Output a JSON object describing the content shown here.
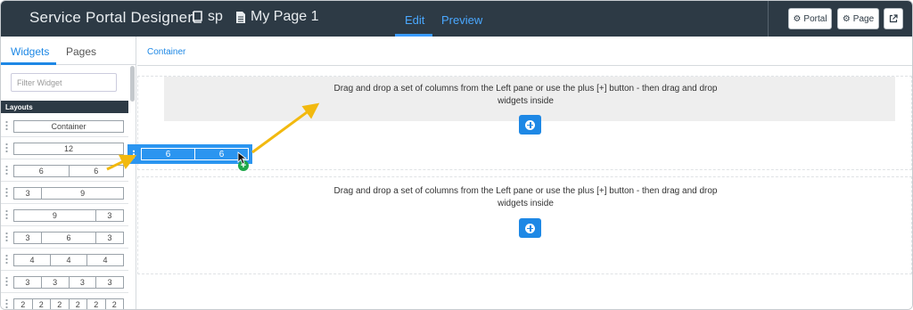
{
  "header": {
    "title": "Service Portal Designer",
    "portal_crumb": "sp",
    "page_crumb": "My Page 1",
    "tabs": {
      "edit": "Edit",
      "preview": "Preview"
    },
    "buttons": {
      "portal": "Portal",
      "page": "Page"
    }
  },
  "sidebar": {
    "tabs": {
      "widgets": "Widgets",
      "pages": "Pages"
    },
    "filter_placeholder": "Filter Widget",
    "layouts_header": "Layouts",
    "layouts": [
      [
        "Container"
      ],
      [
        "12"
      ],
      [
        "6",
        "6"
      ],
      [
        "3",
        "9"
      ],
      [
        "9",
        "3"
      ],
      [
        "3",
        "6",
        "3"
      ],
      [
        "4",
        "4",
        "4"
      ],
      [
        "3",
        "3",
        "3",
        "3"
      ],
      [
        "2",
        "2",
        "2",
        "2",
        "2",
        "2"
      ]
    ]
  },
  "main": {
    "breadcrumb": "Container",
    "drop_message_line1": "Drag and drop a set of columns from the Left pane or use the plus [+] button - then drag and drop",
    "drop_message_line2": "widgets inside"
  },
  "drag_ghost": {
    "cols": [
      "6",
      "6"
    ]
  },
  "colors": {
    "topbar": "#2d3a45",
    "accent": "#1e88e5",
    "arrow": "#f2b90f",
    "drop_ok": "#1fa84a"
  }
}
